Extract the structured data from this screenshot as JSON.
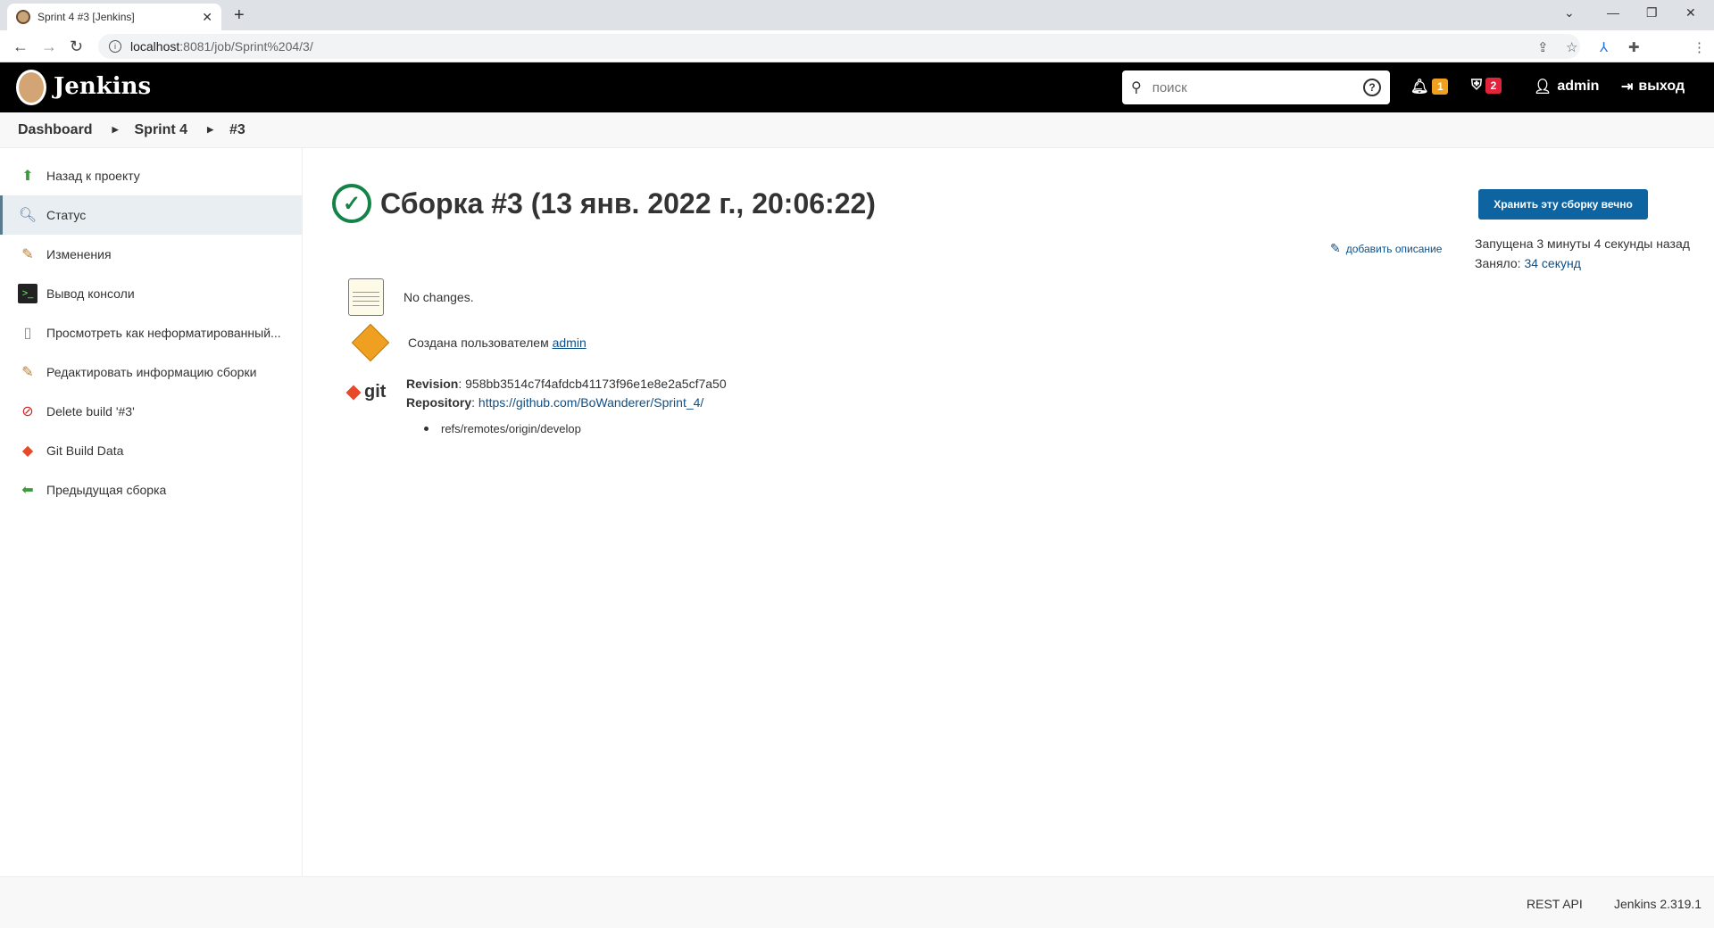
{
  "browser": {
    "tab_title": "Sprint 4 #3 [Jenkins]",
    "url_host": "localhost",
    "url_path": ":8081/job/Sprint%204/3/"
  },
  "header": {
    "brand": "Jenkins",
    "search_placeholder": "поиск",
    "notifications_count": "1",
    "security_count": "2",
    "user": "admin",
    "logout": "выход"
  },
  "breadcrumb": [
    "Dashboard",
    "Sprint 4",
    "#3"
  ],
  "sidebar": {
    "items": [
      {
        "label": "Назад к проекту",
        "icon": "up-arrow-icon"
      },
      {
        "label": "Статус",
        "icon": "magnifier-icon"
      },
      {
        "label": "Изменения",
        "icon": "notepad-icon"
      },
      {
        "label": "Вывод консоли",
        "icon": "terminal-icon"
      },
      {
        "label": "Просмотреть как неформатированный...",
        "icon": "document-icon"
      },
      {
        "label": "Редактировать информацию сборки",
        "icon": "edit-notepad-icon"
      },
      {
        "label": "Delete build '#3'",
        "icon": "no-entry-icon"
      },
      {
        "label": "Git Build Data",
        "icon": "git-icon"
      },
      {
        "label": "Предыдущая сборка",
        "icon": "left-arrow-icon"
      }
    ]
  },
  "main": {
    "title": "Сборка #3 (13 янв. 2022 г., 20:06:22)",
    "keep_button": "Хранить эту сборку вечно",
    "add_description": "добавить описание",
    "started": "Запущена 3 минуты 4 секунды назад",
    "took_label": "Заняло:",
    "took_value": "34 секунд",
    "no_changes": "No changes.",
    "created_by_label": "Создана пользователем",
    "created_by_user": "admin",
    "git_label": "git",
    "revision_label": "Revision",
    "revision_value": ": 958bb3514c7f4afdcb41173f96e1e8e2a5cf7a50",
    "repository_label": "Repository",
    "repository_value": "https://github.com/BoWanderer/Sprint_4/",
    "branch": "refs/remotes/origin/develop"
  },
  "footer": {
    "rest_api": "REST API",
    "version": "Jenkins 2.319.1"
  },
  "colors": {
    "success": "#138347",
    "primary_button": "#0d64a1",
    "link": "#0d4f87",
    "badge_warning": "#f0a020",
    "badge_danger": "#e0243c"
  }
}
